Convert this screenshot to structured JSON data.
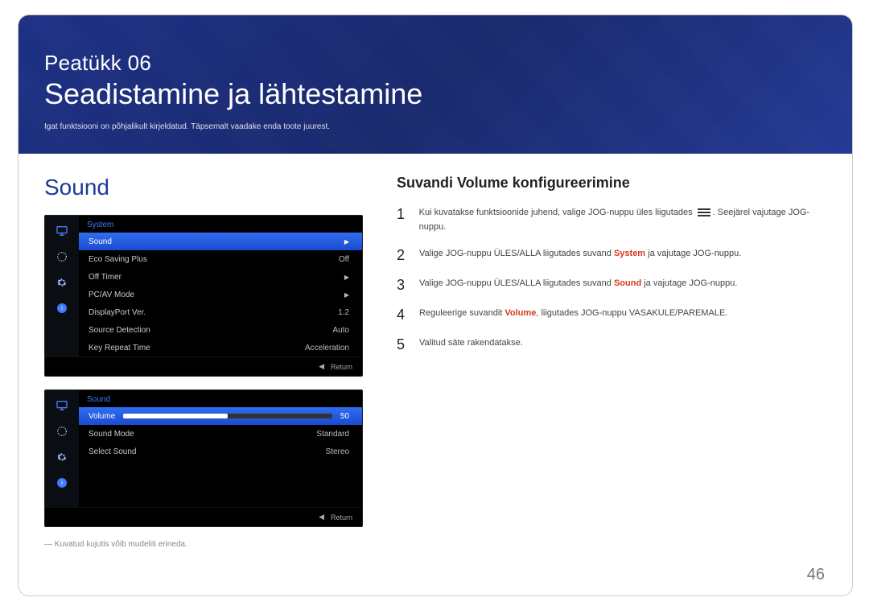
{
  "hero": {
    "chapter_label": "Peatükk  06",
    "chapter_title": "Seadistamine ja lähtestamine",
    "chapter_sub": "Igat funktsiooni on põhjalikult kirjeldatud. Täpsemalt vaadake enda toote juurest."
  },
  "left": {
    "sound_heading": "Sound",
    "osd1": {
      "title": "System",
      "rows": [
        {
          "label": "Sound",
          "value": "",
          "selected": true,
          "arrow": true
        },
        {
          "label": "Eco Saving Plus",
          "value": "Off"
        },
        {
          "label": "Off Timer",
          "value": "",
          "arrow": true
        },
        {
          "label": "PC/AV Mode",
          "value": "",
          "arrow": true
        },
        {
          "label": "DisplayPort Ver.",
          "value": "1.2"
        },
        {
          "label": "Source Detection",
          "value": "Auto"
        },
        {
          "label": "Key Repeat Time",
          "value": "Acceleration"
        }
      ],
      "return": "Return"
    },
    "osd2": {
      "title": "Sound",
      "rows": [
        {
          "label": "Volume",
          "value": "50",
          "selected": true,
          "slider": 50
        },
        {
          "label": "Sound Mode",
          "value": "Standard"
        },
        {
          "label": "Select Sound",
          "value": "Stereo"
        }
      ],
      "return": "Return"
    },
    "footnote": "Kuvatud kujutis võib mudeliti erineda."
  },
  "right": {
    "subheading": "Suvandi Volume konfigureerimine",
    "steps": [
      {
        "num": "1",
        "pre": "Kui kuvatakse funktsioonide juhend, valige JOG-nuppu üles liigutades ",
        "icon": true,
        "post": ". Seejärel vajutage JOG-nuppu."
      },
      {
        "num": "2",
        "pre": "Valige JOG-nuppu ÜLES/ALLA liigutades suvand ",
        "hl": "System",
        "hlclass": "hl-system",
        "post": " ja vajutage JOG-nuppu."
      },
      {
        "num": "3",
        "pre": "Valige JOG-nuppu ÜLES/ALLA liigutades suvand ",
        "hl": "Sound",
        "hlclass": "hl-sound",
        "post": " ja vajutage JOG-nuppu."
      },
      {
        "num": "4",
        "pre": "Reguleerige suvandit ",
        "hl": "Volume",
        "hlclass": "hl-volume",
        "post": ", liigutades JOG-nuppu VASAKULE/PAREMALE."
      },
      {
        "num": "5",
        "pre": "Valitud säte rakendatakse.",
        "post": ""
      }
    ]
  },
  "page_number": "46"
}
